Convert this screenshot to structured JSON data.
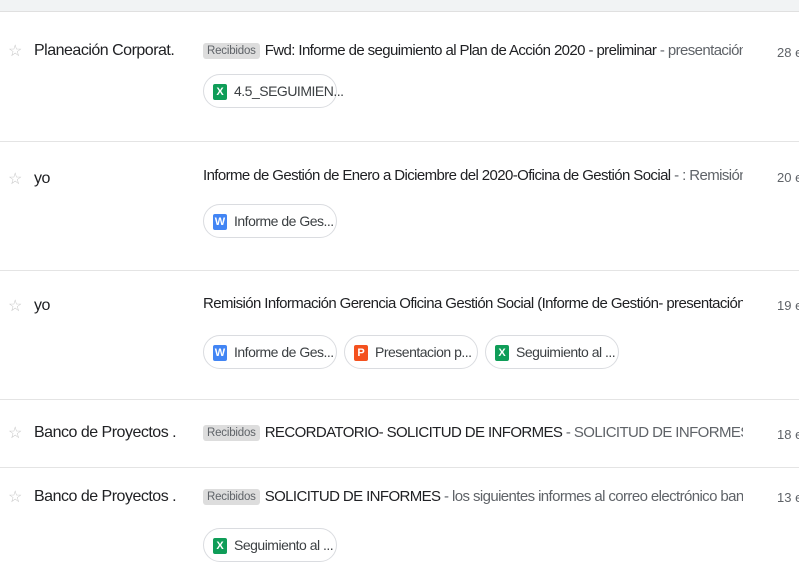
{
  "emails": [
    {
      "sender": "Planeación Corporat.",
      "label": "Recibidos",
      "subject": "Fwd: Informe de seguimiento al Plan de Acción 2020 - preliminar",
      "snippet": "presentación de i...",
      "date": "28 e",
      "attachments": [
        {
          "type": "excel",
          "icon": "X",
          "name": "4.5_SEGUIMIEN..."
        }
      ]
    },
    {
      "sender": "yo",
      "label": "",
      "subject": "Informe de Gestión de Enero a Diciembre del 2020-Oficina de Gestión Social",
      "snippet": ": Remisión Infor...",
      "date": "20 e",
      "attachments": [
        {
          "type": "word",
          "icon": "W",
          "name": "Informe de Ges..."
        }
      ]
    },
    {
      "sender": "yo",
      "label": "",
      "subject": "Remisión Información Gerencia Oficina Gestión Social (Informe de Gestión- presentación diapo...",
      "snippet": "",
      "date": "19 e",
      "attachments": [
        {
          "type": "word",
          "icon": "W",
          "name": "Informe de Ges..."
        },
        {
          "type": "powerpoint",
          "icon": "P",
          "name": "Presentacion p..."
        },
        {
          "type": "excel",
          "icon": "X",
          "name": "Seguimiento al ..."
        }
      ]
    },
    {
      "sender": "Banco de Proyectos .",
      "label": "Recibidos",
      "subject": "RECORDATORIO- SOLICITUD DE INFORMES",
      "snippet": "SOLICITUD DE INFORMES To: Subgeren...",
      "date": "18 e",
      "attachments": []
    },
    {
      "sender": "Banco de Proyectos .",
      "label": "Recibidos",
      "subject": "SOLICITUD DE INFORMES",
      "snippet": "los siguientes informes al correo electrónico bancodepr...",
      "date": "13 e",
      "attachments": [
        {
          "type": "excel",
          "icon": "X",
          "name": "Seguimiento al ..."
        }
      ]
    }
  ],
  "separator": "-",
  "star_glyph": "☆",
  "colors": {
    "excel": "#0f9d58",
    "word": "#4285f4",
    "powerpoint": "#f4511e",
    "label_bg": "#dddddd"
  }
}
